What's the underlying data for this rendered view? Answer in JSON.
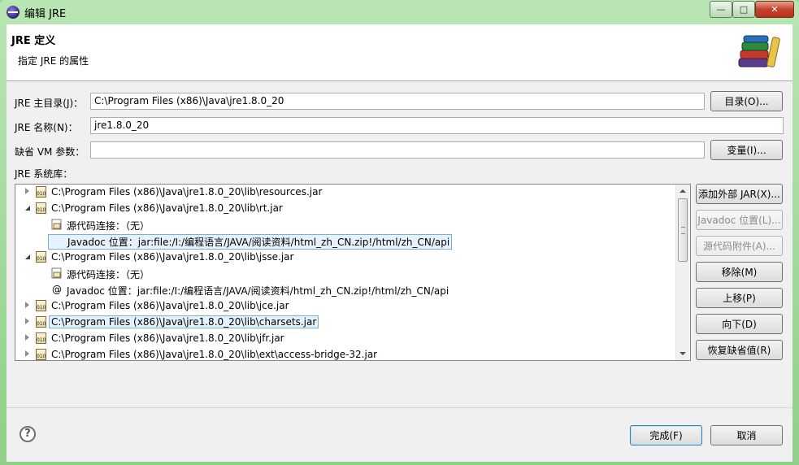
{
  "window": {
    "title": "编辑 JRE"
  },
  "header": {
    "title": "JRE 定义",
    "subtitle": "指定 JRE 的属性"
  },
  "fields": {
    "home": {
      "label": "JRE 主目录(J)：",
      "value": "C:\\Program Files (x86)\\Java\\jre1.8.0_20",
      "button": "目录(O)..."
    },
    "name": {
      "label": "JRE 名称(N)：",
      "value": "jre1.8.0_20"
    },
    "vmargs": {
      "label": "缺省 VM 参数：",
      "value": "",
      "button": "变量(I)..."
    }
  },
  "libraries": {
    "label": "JRE 系统库：",
    "rows": [
      {
        "text": "C:\\Program Files (x86)\\Java\\jre1.8.0_20\\lib\\resources.jar"
      },
      {
        "text": "C:\\Program Files (x86)\\Java\\jre1.8.0_20\\lib\\rt.jar"
      },
      {
        "text": "源代码连接：（无）"
      },
      {
        "text": "Javadoc 位置：jar:file:/I:/编程语言/JAVA/阅读资料/html_zh_CN.zip!/html/zh_CN/api"
      },
      {
        "text": "C:\\Program Files (x86)\\Java\\jre1.8.0_20\\lib\\jsse.jar"
      },
      {
        "text": "源代码连接：（无）"
      },
      {
        "text": "Javadoc 位置：jar:file:/I:/编程语言/JAVA/阅读资料/html_zh_CN.zip!/html/zh_CN/api"
      },
      {
        "text": "C:\\Program Files (x86)\\Java\\jre1.8.0_20\\lib\\jce.jar"
      },
      {
        "text": "C:\\Program Files (x86)\\Java\\jre1.8.0_20\\lib\\charsets.jar"
      },
      {
        "text": "C:\\Program Files (x86)\\Java\\jre1.8.0_20\\lib\\jfr.jar"
      },
      {
        "text": "C:\\Program Files (x86)\\Java\\jre1.8.0_20\\lib\\ext\\access-bridge-32.jar"
      }
    ],
    "buttons": {
      "add_external": "添加外部 JAR(X)...",
      "javadoc": "Javadoc 位置(L)...",
      "source": "源代码附件(A)...",
      "remove": "移除(M)",
      "up": "上移(P)",
      "down": "向下(D)",
      "restore": "恢复缺省值(R)"
    }
  },
  "footer": {
    "finish": "完成(F)",
    "cancel": "取消"
  },
  "icons": {
    "app": "eclipse-icon",
    "header": "books-icon",
    "jar": "jar-icon",
    "help": "help-icon"
  },
  "colors": {
    "frame": "#9fd29a",
    "selection": "#e5f1fb",
    "selection_border": "#7aafd6"
  }
}
